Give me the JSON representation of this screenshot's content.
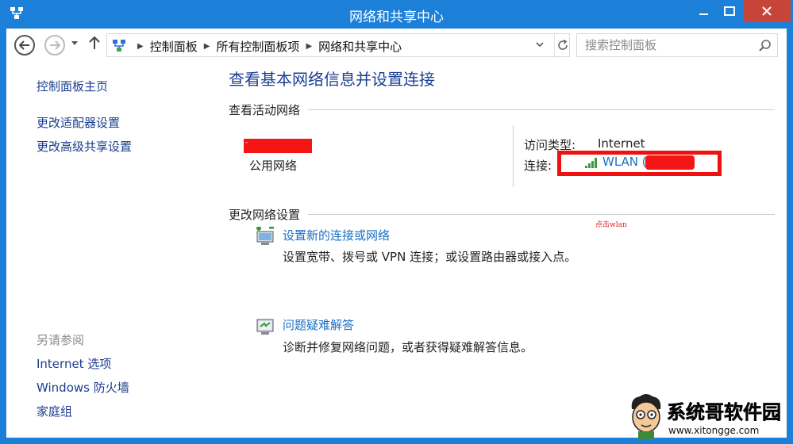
{
  "window": {
    "title": "网络和共享中心"
  },
  "nav": {
    "breadcrumbs": [
      "控制面板",
      "所有控制面板项",
      "网络和共享中心"
    ],
    "search_placeholder": "搜索控制面板"
  },
  "sidebar": {
    "links": [
      "控制面板主页",
      "更改适配器设置",
      "更改高级共享设置"
    ],
    "see_also_heading": "另请参阅",
    "see_also": [
      "Internet 选项",
      "Windows 防火墙",
      "家庭组"
    ]
  },
  "main": {
    "title": "查看基本网络信息并设置连接",
    "active_heading": "查看活动网络",
    "network_type": "公用网络",
    "access_label": "访问类型:",
    "access_value": "Internet",
    "connection_label": "连接:",
    "connection_value": "WLAN (",
    "annotation": "点击wlan",
    "change_heading": "更改网络设置",
    "tasks": [
      {
        "title": "设置新的连接或网络",
        "desc": "设置宽带、拨号或 VPN 连接；或设置路由器或接入点。"
      },
      {
        "title": "问题疑难解答",
        "desc": "诊断并修复网络问题，或者获得疑难解答信息。"
      }
    ]
  },
  "watermark": {
    "name": "系统哥软件园",
    "url": "www.xitongge.com"
  },
  "colors": {
    "titlebar": "#1c7fd8",
    "close": "#c74538",
    "link": "#1a6fc5",
    "heading": "#1b3f93",
    "highlight": "#f01010"
  }
}
